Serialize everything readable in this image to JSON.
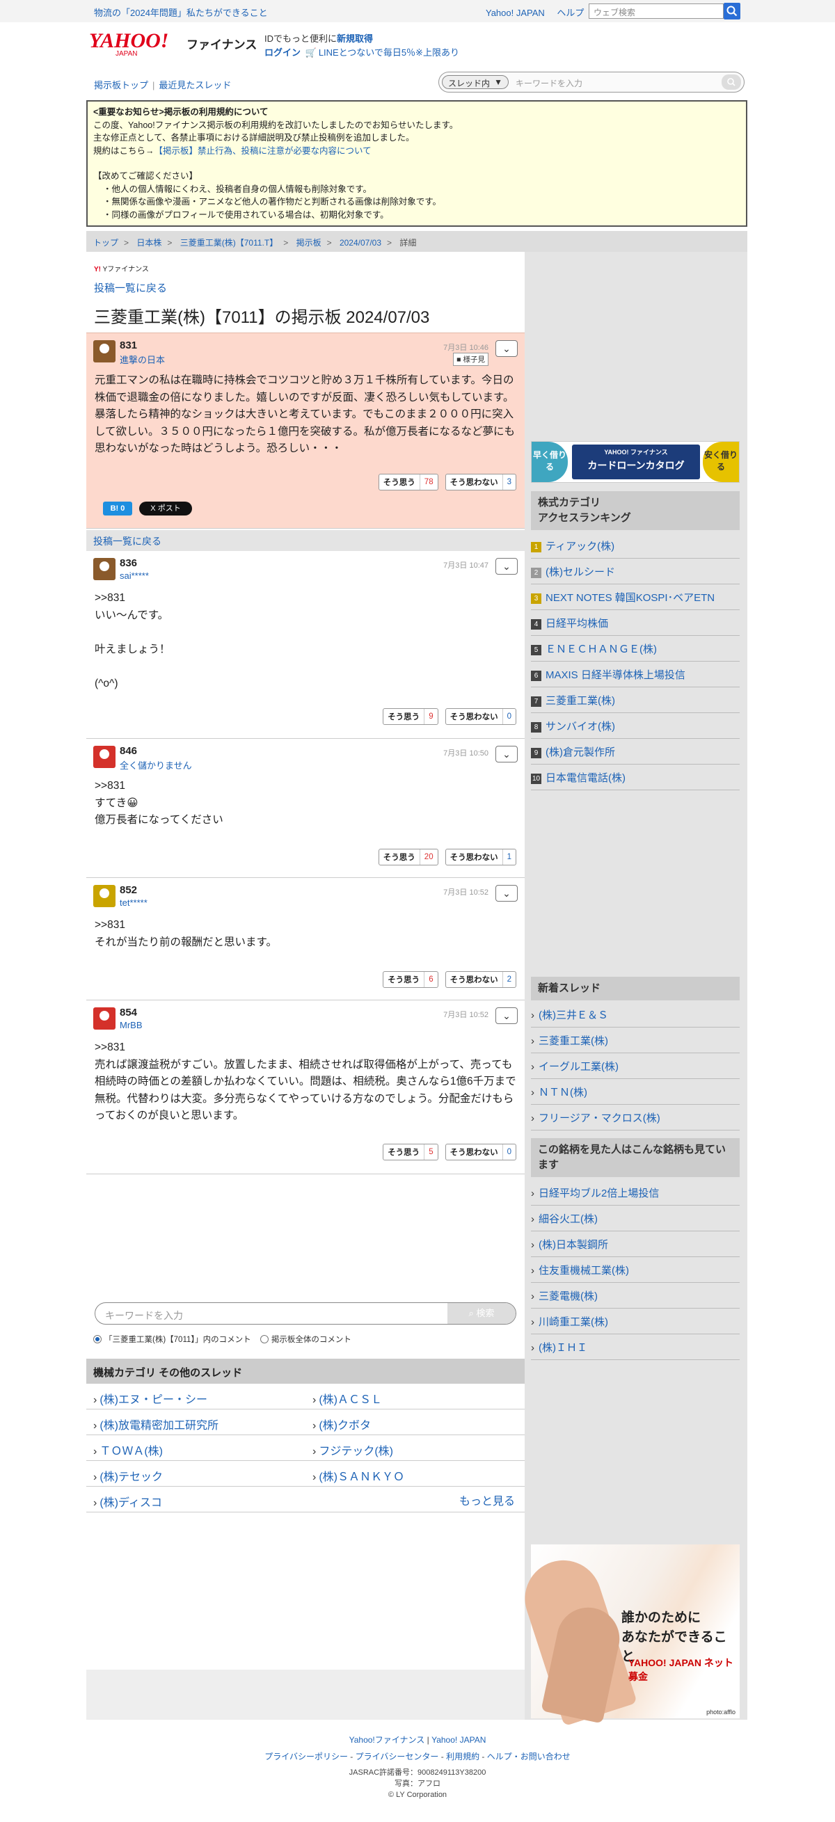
{
  "topbar": {
    "notice_link": "物流の「2024年問題」私たちができること",
    "yahoo_japan": "Yahoo! JAPAN",
    "help": "ヘルプ",
    "search_placeholder": "ウェブ検索"
  },
  "header": {
    "logo_text": "YAHOO! JAPAN",
    "finance": "ファイナンス",
    "id_line1_a": "IDでもっと便利に",
    "id_line1_b": "新規取得",
    "login": "ログイン",
    "line_promo": "LINEとつないで毎日5％※上限あり"
  },
  "nav": {
    "board_top": "掲示板トップ",
    "recent": "最近見たスレッド",
    "scope": "スレッド内",
    "search_placeholder": "キーワードを入力"
  },
  "notice": {
    "title": "<重要なお知らせ>掲示板の利用規約について",
    "lines": [
      "この度、Yahoo!ファイナンス掲示板の利用規約を改訂いたしましたのでお知らせいたします。",
      "主な修正点として、各禁止事項における詳細説明及び禁止投稿例を追加しました。"
    ],
    "rules_prefix": "規約はこちら→",
    "rules_link": "【掲示板】禁止行為、投稿に注意が必要な内容について",
    "confirm": "【改めてご確認ください】",
    "bullets": [
      "・他人の個人情報にくわえ、投稿者自身の個人情報も削除対象です。",
      "・無関係な画像や漫画・アニメなど他人の著作物だと判断される画像は削除対象です。",
      "・同様の画像がプロフィールで使用されている場合は、初期化対象です。"
    ]
  },
  "breadcrumb": [
    "トップ",
    "日本株",
    "三菱重工業(株)【7011.T】",
    "掲示板",
    "2024/07/03",
    "詳細"
  ],
  "main": {
    "sublogo": "Yファイナンス",
    "back_to_list": "投稿一覧に戻る",
    "title": "三菱重工業(株)【7011】の掲示板 2024/07/03",
    "share_bm": "B! 0",
    "share_x": "X ポスト"
  },
  "vote_labels": {
    "agree": "そう思う",
    "disagree": "そう思わない"
  },
  "posts": [
    {
      "num": "831",
      "name": "進撃の日本",
      "time": "7月3日 10:46",
      "tag": "様子見",
      "body": "元重工マンの私は在職時に持株会でコツコツと貯め３万１千株所有しています。今日の株価で退職金の倍になりました。嬉しいのですが反面、凄く恐ろしい気もしています。暴落したら精神的なショックは大きいと考えています。でもこのまま２０００円に突入して欲しい。３５００円になったら１億円を突破する。私が億万長者になるなど夢にも思わないがなった時はどうしよう。恐ろしい・・・",
      "agree": "78",
      "disagree": "3"
    },
    {
      "num": "836",
      "name": "sai*****",
      "time": "7月3日 10:47",
      "body": ">>831\nいい〜んです。\n\n叶えましょう！\n\n(^o^)",
      "agree": "9",
      "disagree": "0"
    },
    {
      "num": "846",
      "name": "全く儲かりません",
      "time": "7月3日 10:50",
      "body": ">>831\nすてき😀\n億万長者になってください",
      "agree": "20",
      "disagree": "1"
    },
    {
      "num": "852",
      "name": "tet*****",
      "time": "7月3日 10:52",
      "body": ">>831\nそれが当たり前の報酬だと思います。",
      "agree": "6",
      "disagree": "2"
    },
    {
      "num": "854",
      "name": "MrBB",
      "time": "7月3日 10:52",
      "body": ">>831\n売れば譲渡益税がすごい。放置したまま、相続させれば取得価格が上がって、売っても相続時の時価との差額しか払わなくていい。問題は、相続税。奥さんなら1億6千万まで無税。代替わりは大変。多分売らなくてやっていける方なのでしょう。分配金だけもらっておくのが良いと思います。",
      "agree": "5",
      "disagree": "0"
    }
  ],
  "bottom_search": {
    "placeholder": "キーワードを入力",
    "button": "検索",
    "radio1": "「三菱重工業(株)【7011】」内のコメント",
    "radio2": "掲示板全体のコメント"
  },
  "other_threads": {
    "heading": "機械カテゴリ その他のスレッド",
    "items": [
      "(株)エヌ・ピー・シー",
      "(株)ＡＣＳＬ",
      "(株)放電精密加工研究所",
      "(株)クボタ",
      "ＴＯＷＡ(株)",
      "フジテック(株)",
      "(株)テセック",
      "(株)ＳＡＮＫＹＯ",
      "(株)ディスコ"
    ],
    "more": "もっと見る"
  },
  "sidebar": {
    "ad1": {
      "left": "早く借りる",
      "center_small": "YAHOO! ファイナンス",
      "center": "カードローンカタログ",
      "right": "安く借りる"
    },
    "ranking_heading": "株式カテゴリ\nアクセスランキング",
    "ranking": [
      {
        "n": "1",
        "name": "ティアック(株)"
      },
      {
        "n": "2",
        "name": "(株)セルシード"
      },
      {
        "n": "3",
        "name": "NEXT NOTES 韓国KOSPI･ベアETN"
      },
      {
        "n": "4",
        "name": "日経平均株価"
      },
      {
        "n": "5",
        "name": "ＥＮＥＣＨＡＮＧＥ(株)"
      },
      {
        "n": "6",
        "name": "MAXIS 日経半導体株上場投信"
      },
      {
        "n": "7",
        "name": "三菱重工業(株)"
      },
      {
        "n": "8",
        "name": "サンバイオ(株)"
      },
      {
        "n": "9",
        "name": "(株)倉元製作所"
      },
      {
        "n": "10",
        "name": "日本電信電話(株)"
      }
    ],
    "new_heading": "新着スレッド",
    "new_threads": [
      "(株)三井Ｅ＆Ｓ",
      "三菱重工業(株)",
      "イーグル工業(株)",
      "ＮＴＮ(株)",
      "フリージア・マクロス(株)"
    ],
    "viewed_heading": "この銘柄を見た人はこんな銘柄も見ています",
    "viewed": [
      "日経平均ブル2倍上場投信",
      "細谷火工(株)",
      "(株)日本製鋼所",
      "住友重機械工業(株)",
      "三菱電機(株)",
      "川崎重工業(株)",
      "(株)ＩＨＩ"
    ],
    "ad2": {
      "text": "誰かのために\nあなたができること",
      "brand": "YAHOO! JAPAN ネット募金",
      "credit": "photo:afflo"
    }
  },
  "footer": {
    "l1a": "Yahoo!ファイナンス",
    "l1b": "Yahoo! JAPAN",
    "l2": [
      "プライバシーポリシー",
      "プライバシーセンター",
      "利用規約",
      "ヘルプ・お問い合わせ"
    ],
    "jasrac": "JASRAC許諾番号：9008249113Y38200",
    "photo": "写真：アフロ",
    "copy": "© LY Corporation"
  }
}
